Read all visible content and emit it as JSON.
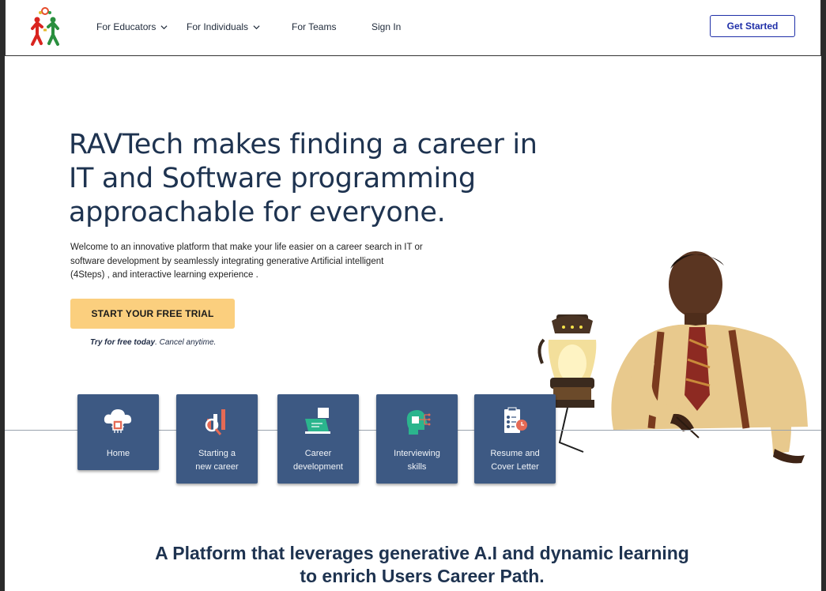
{
  "header": {
    "nav": [
      {
        "label": "For Educators",
        "has_dropdown": true
      },
      {
        "label": "For Individuals",
        "has_dropdown": true
      },
      {
        "label": "For Teams",
        "has_dropdown": false
      },
      {
        "label": "Sign In",
        "has_dropdown": false
      }
    ],
    "get_started": "Get Started"
  },
  "hero": {
    "title_line1": "RAVTech makes finding a career in",
    "title_line2": "IT and Software programming",
    "title_line3": "approachable for everyone.",
    "desc_line1": "Welcome to an innovative platform that  make your life easier on a career search in IT or",
    "desc_line2": "software development by seamlessly integrating generative Artificial intelligent",
    "desc_line3": "(4Steps) , and interactive learning experience .",
    "cta": "START YOUR FREE TRIAL",
    "note_bold": "Try for free today",
    "note_rest": ". Cancel anytime."
  },
  "cards": [
    {
      "line1": "Home",
      "line2": "",
      "icon": "cloud-chip-icon"
    },
    {
      "line1": "Starting a",
      "line2": "new career",
      "icon": "chart-magnifier-icon"
    },
    {
      "line1": "Career",
      "line2": "development",
      "icon": "laptop-icon"
    },
    {
      "line1": "Interviewing",
      "line2": "skills",
      "icon": "head-network-icon"
    },
    {
      "line1": "Resume and",
      "line2": "Cover Letter",
      "icon": "clipboard-checklist-icon"
    }
  ],
  "tagline": {
    "line1": "A Platform that leverages generative A.I and dynamic learning",
    "line2": "to enrich Users Career Path."
  },
  "colors": {
    "card_bg": "#3d5983",
    "cta_bg": "#fbcf7e",
    "heading": "#1e3350",
    "accent": "#1f2fa8"
  }
}
